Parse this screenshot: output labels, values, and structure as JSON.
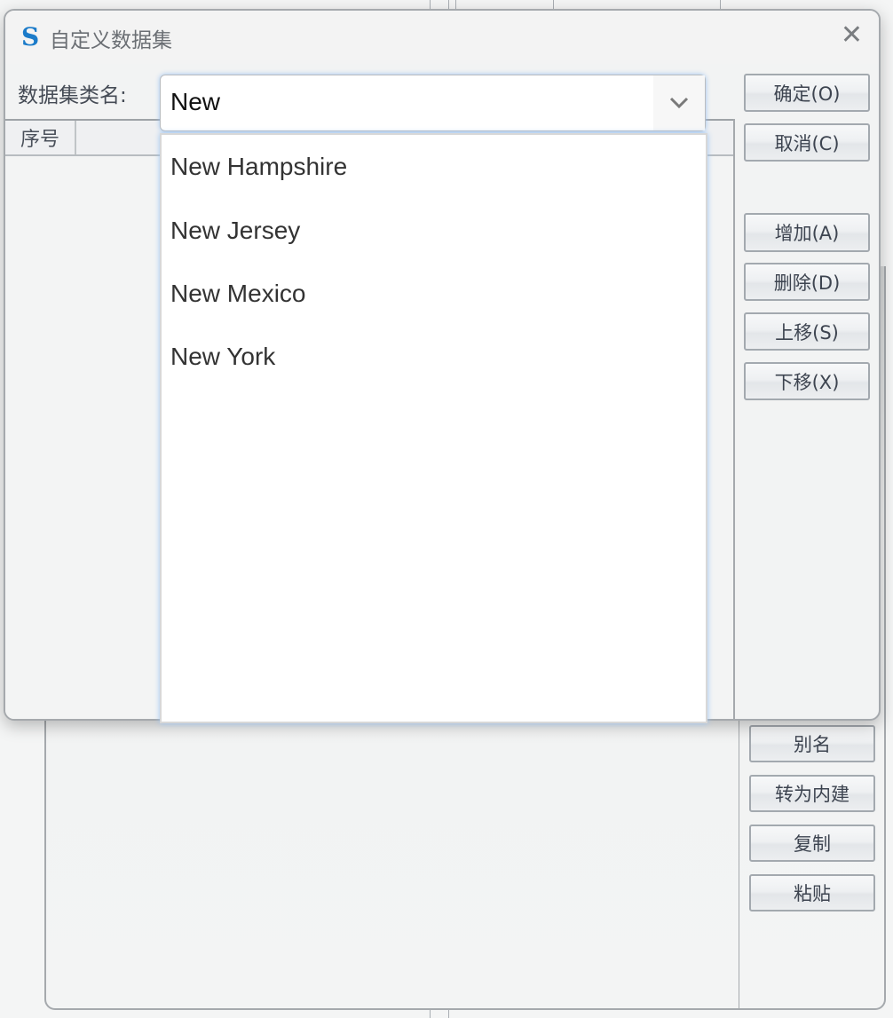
{
  "dialog": {
    "title": "自定义数据集",
    "logo": "S",
    "close_icon": "close-icon",
    "name_label": "数据集类名:",
    "combo_value": "New",
    "dropdown_options": [
      "New Hampshire",
      "New Jersey",
      "New Mexico",
      "New York"
    ],
    "table_header": [
      "序号"
    ],
    "buttons": {
      "ok": "确定(O)",
      "cancel": "取消(C)",
      "add": "增加(A)",
      "delete": "删除(D)",
      "up": "上移(S)",
      "down": "下移(X)"
    }
  },
  "background_window": {
    "buttons": {
      "alias": "别名",
      "to_builtin": "转为内建",
      "copy": "复制",
      "paste": "粘贴"
    }
  },
  "colors": {
    "accent": "#1b7bc9",
    "focus_glow": "#9cc4f2"
  }
}
